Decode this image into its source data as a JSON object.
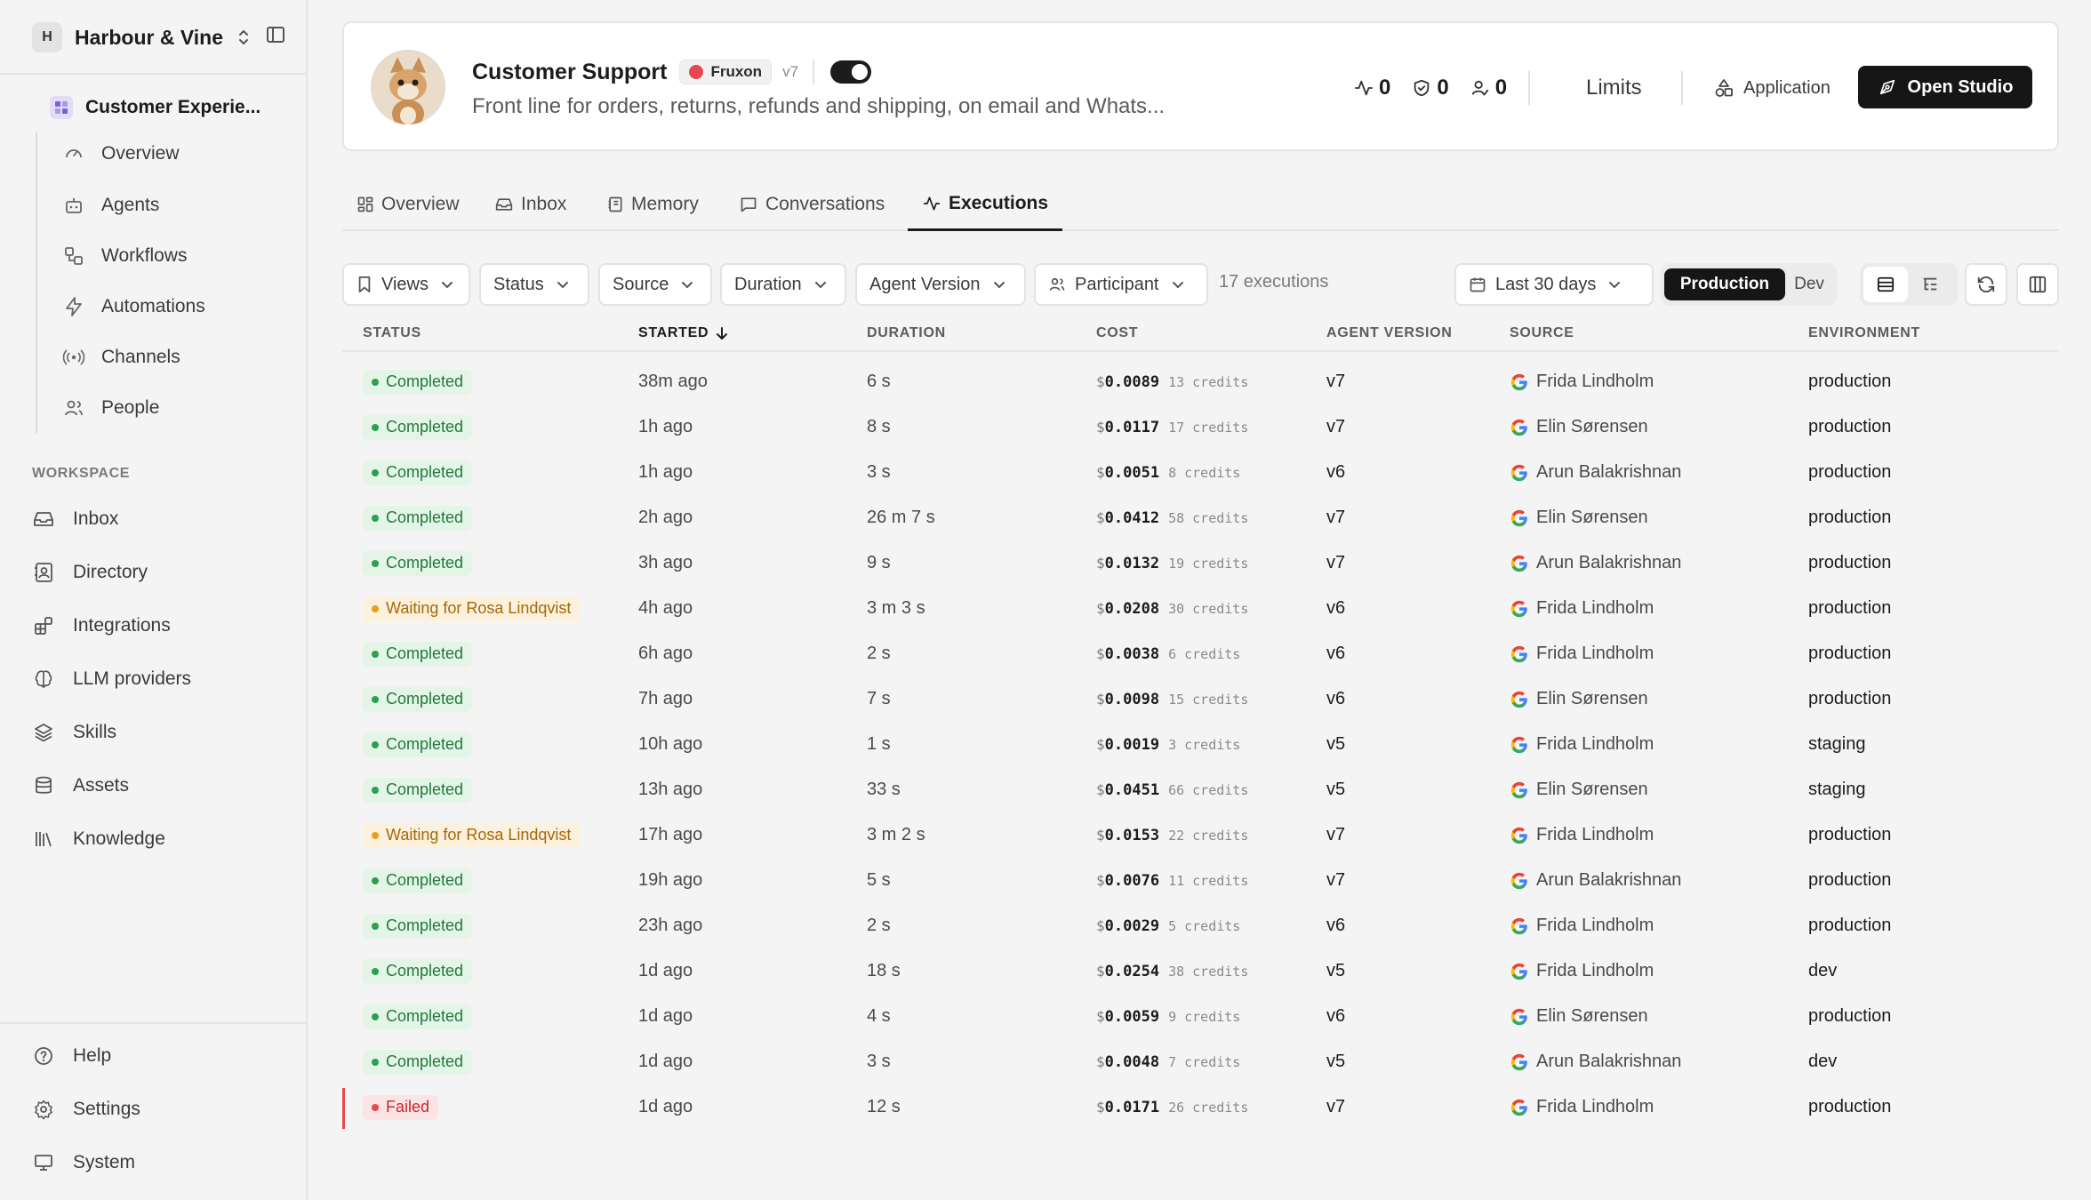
{
  "sidebar": {
    "org_initial": "H",
    "org_name": "Harbour & Vine",
    "project": "Customer Experie...",
    "project_items": [
      {
        "label": "Overview",
        "icon": "gauge-icon"
      },
      {
        "label": "Agents",
        "icon": "bot-icon"
      },
      {
        "label": "Workflows",
        "icon": "workflow-icon"
      },
      {
        "label": "Automations",
        "icon": "zap-icon"
      },
      {
        "label": "Channels",
        "icon": "radio-icon"
      },
      {
        "label": "People",
        "icon": "users-icon"
      }
    ],
    "workspace_label": "WORKSPACE",
    "workspace_items": [
      {
        "label": "Inbox",
        "icon": "inbox-icon"
      },
      {
        "label": "Directory",
        "icon": "contact-book-icon"
      },
      {
        "label": "Integrations",
        "icon": "blocks-icon"
      },
      {
        "label": "LLM providers",
        "icon": "brain-icon"
      },
      {
        "label": "Skills",
        "icon": "layers-icon"
      },
      {
        "label": "Assets",
        "icon": "database-icon"
      },
      {
        "label": "Knowledge",
        "icon": "library-icon"
      }
    ],
    "footer_items": [
      {
        "label": "Help",
        "icon": "help-icon"
      },
      {
        "label": "Settings",
        "icon": "gear-icon"
      },
      {
        "label": "System",
        "icon": "monitor-icon"
      }
    ]
  },
  "header": {
    "agent_name": "Customer Support",
    "brand": "Fruxon",
    "version": "v7",
    "enabled": true,
    "description": "Front line for orders, returns, refunds and shipping, on email and Whats...",
    "stats": [
      {
        "icon": "activity-icon",
        "value": "0"
      },
      {
        "icon": "shield-check-icon",
        "value": "0"
      },
      {
        "icon": "user-check-icon",
        "value": "0"
      }
    ],
    "limits_label": "Limits",
    "application_label": "Application",
    "open_studio_label": "Open Studio"
  },
  "tabs": [
    {
      "label": "Overview",
      "icon": "dashboard-icon",
      "active": false
    },
    {
      "label": "Inbox",
      "icon": "inbox-icon",
      "active": false
    },
    {
      "label": "Memory",
      "icon": "notebook-icon",
      "active": false
    },
    {
      "label": "Conversations",
      "icon": "message-square-icon",
      "active": false
    },
    {
      "label": "Executions",
      "icon": "activity-icon",
      "active": true
    }
  ],
  "filters": {
    "views": "Views",
    "status": "Status",
    "source": "Source",
    "duration": "Duration",
    "agent_version": "Agent Version",
    "participant": "Participant",
    "count_text": "17 executions",
    "date_range": "Last 30 days",
    "env_production": "Production",
    "env_dev": "Dev"
  },
  "table": {
    "columns": {
      "status": "STATUS",
      "started": "STARTED",
      "duration": "DURATION",
      "cost": "COST",
      "agent_version": "AGENT VERSION",
      "source": "SOURCE",
      "environment": "ENVIRONMENT"
    },
    "currency": "$",
    "rows": [
      {
        "status": "Completed",
        "kind": "completed",
        "started": "38m ago",
        "duration": "6 s",
        "cost": "0.0089",
        "credits": "13 credits",
        "version": "v7",
        "source": "Frida Lindholm",
        "env": "production"
      },
      {
        "status": "Completed",
        "kind": "completed",
        "started": "1h ago",
        "duration": "8 s",
        "cost": "0.0117",
        "credits": "17 credits",
        "version": "v7",
        "source": "Elin Sørensen",
        "env": "production"
      },
      {
        "status": "Completed",
        "kind": "completed",
        "started": "1h ago",
        "duration": "3 s",
        "cost": "0.0051",
        "credits": "8 credits",
        "version": "v6",
        "source": "Arun Balakrishnan",
        "env": "production"
      },
      {
        "status": "Completed",
        "kind": "completed",
        "started": "2h ago",
        "duration": "26 m 7 s",
        "cost": "0.0412",
        "credits": "58 credits",
        "version": "v7",
        "source": "Elin Sørensen",
        "env": "production"
      },
      {
        "status": "Completed",
        "kind": "completed",
        "started": "3h ago",
        "duration": "9 s",
        "cost": "0.0132",
        "credits": "19 credits",
        "version": "v7",
        "source": "Arun Balakrishnan",
        "env": "production"
      },
      {
        "status": "Waiting for Rosa Lindqvist",
        "kind": "waiting",
        "started": "4h ago",
        "duration": "3 m 3 s",
        "cost": "0.0208",
        "credits": "30 credits",
        "version": "v6",
        "source": "Frida Lindholm",
        "env": "production"
      },
      {
        "status": "Completed",
        "kind": "completed",
        "started": "6h ago",
        "duration": "2 s",
        "cost": "0.0038",
        "credits": "6 credits",
        "version": "v6",
        "source": "Frida Lindholm",
        "env": "production"
      },
      {
        "status": "Completed",
        "kind": "completed",
        "started": "7h ago",
        "duration": "7 s",
        "cost": "0.0098",
        "credits": "15 credits",
        "version": "v6",
        "source": "Elin Sørensen",
        "env": "production"
      },
      {
        "status": "Completed",
        "kind": "completed",
        "started": "10h ago",
        "duration": "1 s",
        "cost": "0.0019",
        "credits": "3 credits",
        "version": "v5",
        "source": "Frida Lindholm",
        "env": "staging"
      },
      {
        "status": "Completed",
        "kind": "completed",
        "started": "13h ago",
        "duration": "33 s",
        "cost": "0.0451",
        "credits": "66 credits",
        "version": "v5",
        "source": "Elin Sørensen",
        "env": "staging"
      },
      {
        "status": "Waiting for Rosa Lindqvist",
        "kind": "waiting",
        "started": "17h ago",
        "duration": "3 m 2 s",
        "cost": "0.0153",
        "credits": "22 credits",
        "version": "v7",
        "source": "Frida Lindholm",
        "env": "production"
      },
      {
        "status": "Completed",
        "kind": "completed",
        "started": "19h ago",
        "duration": "5 s",
        "cost": "0.0076",
        "credits": "11 credits",
        "version": "v7",
        "source": "Arun Balakrishnan",
        "env": "production"
      },
      {
        "status": "Completed",
        "kind": "completed",
        "started": "23h ago",
        "duration": "2 s",
        "cost": "0.0029",
        "credits": "5 credits",
        "version": "v6",
        "source": "Frida Lindholm",
        "env": "production"
      },
      {
        "status": "Completed",
        "kind": "completed",
        "started": "1d ago",
        "duration": "18 s",
        "cost": "0.0254",
        "credits": "38 credits",
        "version": "v5",
        "source": "Frida Lindholm",
        "env": "dev"
      },
      {
        "status": "Completed",
        "kind": "completed",
        "started": "1d ago",
        "duration": "4 s",
        "cost": "0.0059",
        "credits": "9 credits",
        "version": "v6",
        "source": "Elin Sørensen",
        "env": "production"
      },
      {
        "status": "Completed",
        "kind": "completed",
        "started": "1d ago",
        "duration": "3 s",
        "cost": "0.0048",
        "credits": "7 credits",
        "version": "v5",
        "source": "Arun Balakrishnan",
        "env": "dev"
      },
      {
        "status": "Failed",
        "kind": "failed",
        "started": "1d ago",
        "duration": "12 s",
        "cost": "0.0171",
        "credits": "26 credits",
        "version": "v7",
        "source": "Frida Lindholm",
        "env": "production"
      }
    ]
  }
}
